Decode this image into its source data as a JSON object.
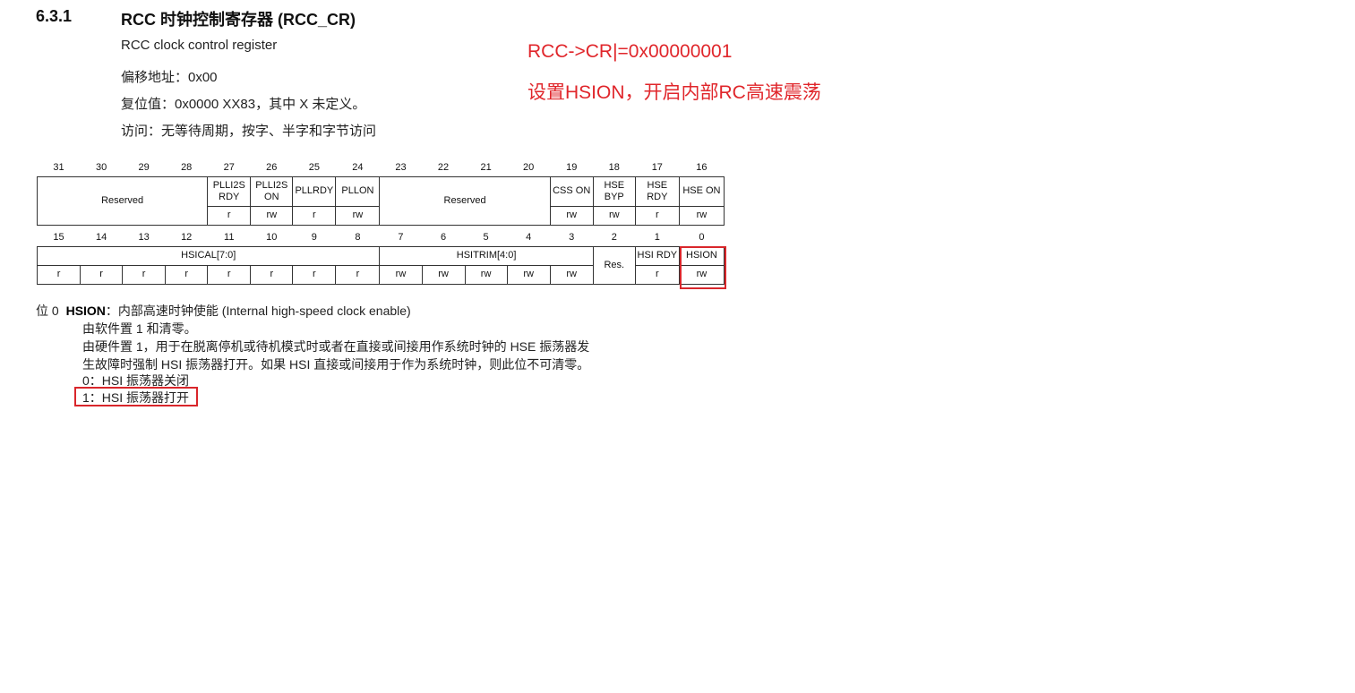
{
  "section": {
    "number": "6.3.1",
    "title": "RCC 时钟控制寄存器 (RCC_CR)",
    "subtitle": "RCC clock control register",
    "offset": "偏移地址：0x00",
    "reset": "复位值：0x0000 XX83，其中 X 未定义。",
    "access": "访问：无等待周期，按字、半字和字节访问"
  },
  "annotation": {
    "line1": "RCC->CR|=0x00000001",
    "line2": "设置HSION，开启内部RC高速震荡",
    "color": "#e0262b"
  },
  "register_high": {
    "bits": [
      "31",
      "30",
      "29",
      "28",
      "27",
      "26",
      "25",
      "24",
      "23",
      "22",
      "21",
      "20",
      "19",
      "18",
      "17",
      "16"
    ],
    "reserved_a": "Reserved",
    "plli2srdy": "PLLI2S RDY",
    "plli2son": "PLLI2S ON",
    "pllrdy": "PLLRDY",
    "pllon": "PLLON",
    "reserved_b": "Reserved",
    "csson": "CSS ON",
    "hsebyp": "HSE BYP",
    "hserdy": "HSE RDY",
    "hseon": "HSE ON",
    "access": [
      "r",
      "rw",
      "r",
      "rw",
      "rw",
      "rw",
      "r",
      "rw"
    ]
  },
  "register_low": {
    "bits": [
      "15",
      "14",
      "13",
      "12",
      "11",
      "10",
      "9",
      "8",
      "7",
      "6",
      "5",
      "4",
      "3",
      "2",
      "1",
      "0"
    ],
    "hsical": "HSICAL[7:0]",
    "hsitrim": "HSITRIM[4:0]",
    "res": "Res.",
    "hsirdy": "HSI RDY",
    "hsion": "HSION",
    "access": [
      "r",
      "r",
      "r",
      "r",
      "r",
      "r",
      "r",
      "r",
      "rw",
      "rw",
      "rw",
      "rw",
      "rw",
      "r",
      "rw"
    ]
  },
  "description": {
    "bit_prefix": "位 0",
    "field": "HSION",
    "field_desc": "：内部高速时钟使能 (Internal high-speed clock enable)",
    "line1": "由软件置 1 和清零。",
    "line2": "由硬件置 1，用于在脱离停机或待机模式时或者在直接或间接用作系统时钟的 HSE 振荡器发",
    "line3": "生故障时强制 HSI 振荡器打开。如果 HSI 直接或间接用于作为系统时钟，则此位不可清零。",
    "opt0": "0：HSI 振荡器关闭",
    "opt1": "1：HSI 振荡器打开"
  },
  "highlight_color": "#d9262b"
}
